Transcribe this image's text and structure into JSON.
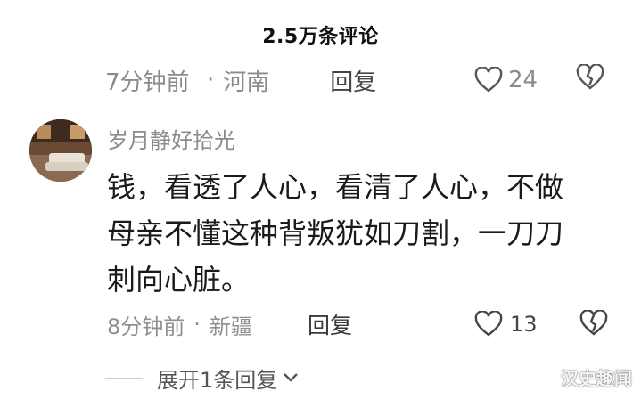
{
  "header": {
    "title": "2.5万条评论"
  },
  "previous_comment": {
    "time": "7分钟前",
    "location": "河南",
    "reply_label": "回复",
    "like_count": "24"
  },
  "comment": {
    "avatar_icon": "avatar-photo",
    "username": "岁月静好拾光",
    "text_lines": [
      "钱，看透了人心，看清了人心，不做",
      "母亲不懂这种背叛犹如刀割，一刀刀",
      "刺向心脏。"
    ],
    "time": "8分钟前",
    "location": "新疆",
    "reply_label": "回复",
    "like_count": "13"
  },
  "expand_replies": {
    "label": "展开1条回复"
  },
  "watermark": "汉史趣闻",
  "colors": {
    "secondary_text": "#8b8b8b",
    "primary_text": "#1a1a1a"
  }
}
